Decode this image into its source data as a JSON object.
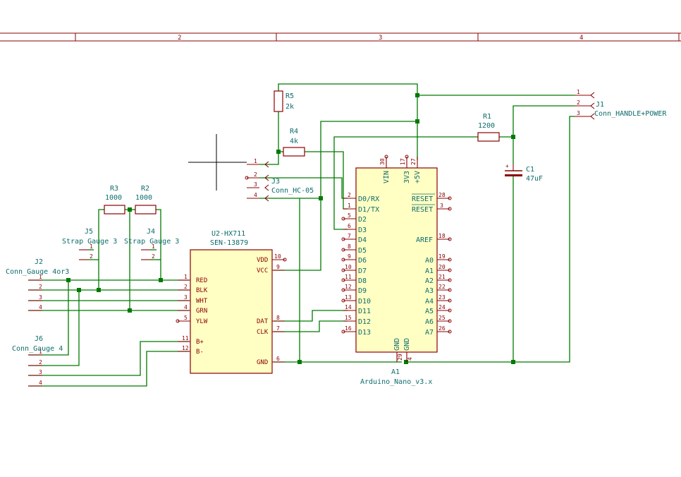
{
  "frame": {
    "columns": [
      "2",
      "3",
      "4"
    ]
  },
  "resistors": [
    {
      "ref": "R5",
      "value": "2k"
    },
    {
      "ref": "R4",
      "value": "4k"
    },
    {
      "ref": "R1",
      "value": "1200"
    },
    {
      "ref": "R3",
      "value": "1000"
    },
    {
      "ref": "R2",
      "value": "1000"
    }
  ],
  "capacitor": {
    "ref": "C1",
    "value": "47uF"
  },
  "j1": {
    "ref": "J1",
    "value": "Conn_HANDLE+POWER",
    "pins": [
      "1",
      "2",
      "3"
    ]
  },
  "j3": {
    "ref": "J3",
    "value": "Conn_HC-05",
    "pins": [
      "1",
      "2",
      "3",
      "4"
    ]
  },
  "j5": {
    "ref": "J5",
    "value": "Strap Gauge 3",
    "pins": [
      "1",
      "2"
    ]
  },
  "j4": {
    "ref": "J4",
    "value": "Strap Gauge 3",
    "pins": [
      "1",
      "2"
    ]
  },
  "j2": {
    "ref": "J2",
    "value": "Conn_Gauge 4or3",
    "pins": [
      "1",
      "2",
      "3",
      "4"
    ]
  },
  "j6": {
    "ref": "J6",
    "value": "Conn_Gauge 4",
    "pins": [
      "1",
      "2",
      "3",
      "4"
    ]
  },
  "u2": {
    "ref": "U2-HX711",
    "value": "SEN-13879",
    "pins_left": [
      {
        "name": "RED",
        "num": "1"
      },
      {
        "name": "BLK",
        "num": "2"
      },
      {
        "name": "WHT",
        "num": "3"
      },
      {
        "name": "GRN",
        "num": "4"
      },
      {
        "name": "YLW",
        "num": "5"
      },
      {
        "name": "B+",
        "num": "11"
      },
      {
        "name": "B-",
        "num": "12"
      }
    ],
    "pins_right": [
      {
        "name": "VDD",
        "num": "10"
      },
      {
        "name": "VCC",
        "num": "9"
      },
      {
        "name": "DAT",
        "num": "8"
      },
      {
        "name": "CLK",
        "num": "7"
      },
      {
        "name": "GND",
        "num": "6"
      }
    ]
  },
  "a1": {
    "ref": "A1",
    "value": "Arduino_Nano_v3.x",
    "pins_left": [
      {
        "name": "D0/RX",
        "num": "2"
      },
      {
        "name": "D1/TX",
        "num": "1"
      },
      {
        "name": "D2",
        "num": "5"
      },
      {
        "name": "D3",
        "num": "6"
      },
      {
        "name": "D4",
        "num": "7"
      },
      {
        "name": "D5",
        "num": "8"
      },
      {
        "name": "D6",
        "num": "9"
      },
      {
        "name": "D7",
        "num": "10"
      },
      {
        "name": "D8",
        "num": "11"
      },
      {
        "name": "D9",
        "num": "12"
      },
      {
        "name": "D10",
        "num": "13"
      },
      {
        "name": "D11",
        "num": "14"
      },
      {
        "name": "D12",
        "num": "15"
      },
      {
        "name": "D13",
        "num": "16"
      }
    ],
    "pins_right": [
      {
        "name": "RESET",
        "num": "28"
      },
      {
        "name": "RESET",
        "num": "3"
      },
      {
        "name": "AREF",
        "num": "18"
      },
      {
        "name": "A0",
        "num": "19"
      },
      {
        "name": "A1",
        "num": "20"
      },
      {
        "name": "A2",
        "num": "21"
      },
      {
        "name": "A3",
        "num": "22"
      },
      {
        "name": "A4",
        "num": "23"
      },
      {
        "name": "A5",
        "num": "24"
      },
      {
        "name": "A6",
        "num": "25"
      },
      {
        "name": "A7",
        "num": "26"
      }
    ],
    "pins_top": [
      {
        "name": "VIN",
        "num": "30"
      },
      {
        "name": "3V3",
        "num": "17"
      },
      {
        "name": "+5V",
        "num": "27"
      }
    ],
    "pins_bottom": [
      {
        "name": "GND",
        "num": "29"
      },
      {
        "name": "GND",
        "num": "4"
      }
    ]
  }
}
